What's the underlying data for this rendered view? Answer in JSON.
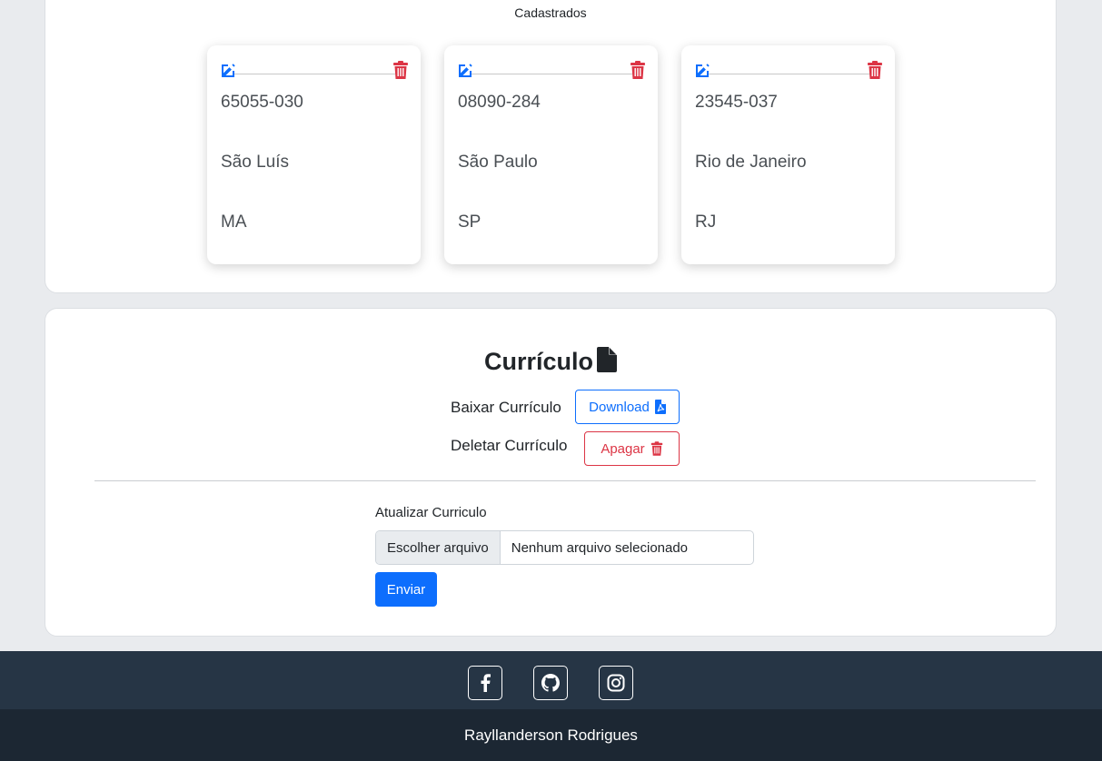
{
  "section": {
    "title": "Cadastrados"
  },
  "addresses": [
    {
      "cep": "65055-030",
      "city": "São Luís",
      "state": "MA"
    },
    {
      "cep": "08090-284",
      "city": "São Paulo",
      "state": "SP"
    },
    {
      "cep": "23545-037",
      "city": "Rio de Janeiro",
      "state": "RJ"
    }
  ],
  "curriculum": {
    "title": "Currículo",
    "download_label": "Baixar Currículo",
    "download_button": "Download",
    "delete_label": "Deletar Currículo",
    "delete_button": "Apagar",
    "update_label": "Atualizar Curriculo",
    "file_button": "Escolher arquivo",
    "file_status": "Nenhum arquivo selecionado",
    "submit_button": "Enviar"
  },
  "footer": {
    "social_icons": [
      "facebook-icon",
      "github-icon",
      "instagram-icon"
    ],
    "author": "Rayllanderson Rodrigues"
  },
  "colors": {
    "primary": "#0d6efd",
    "danger": "#dc3545",
    "footer_top": "#263545",
    "footer_bottom": "#1c2733",
    "page_bg": "#e9ebee"
  }
}
